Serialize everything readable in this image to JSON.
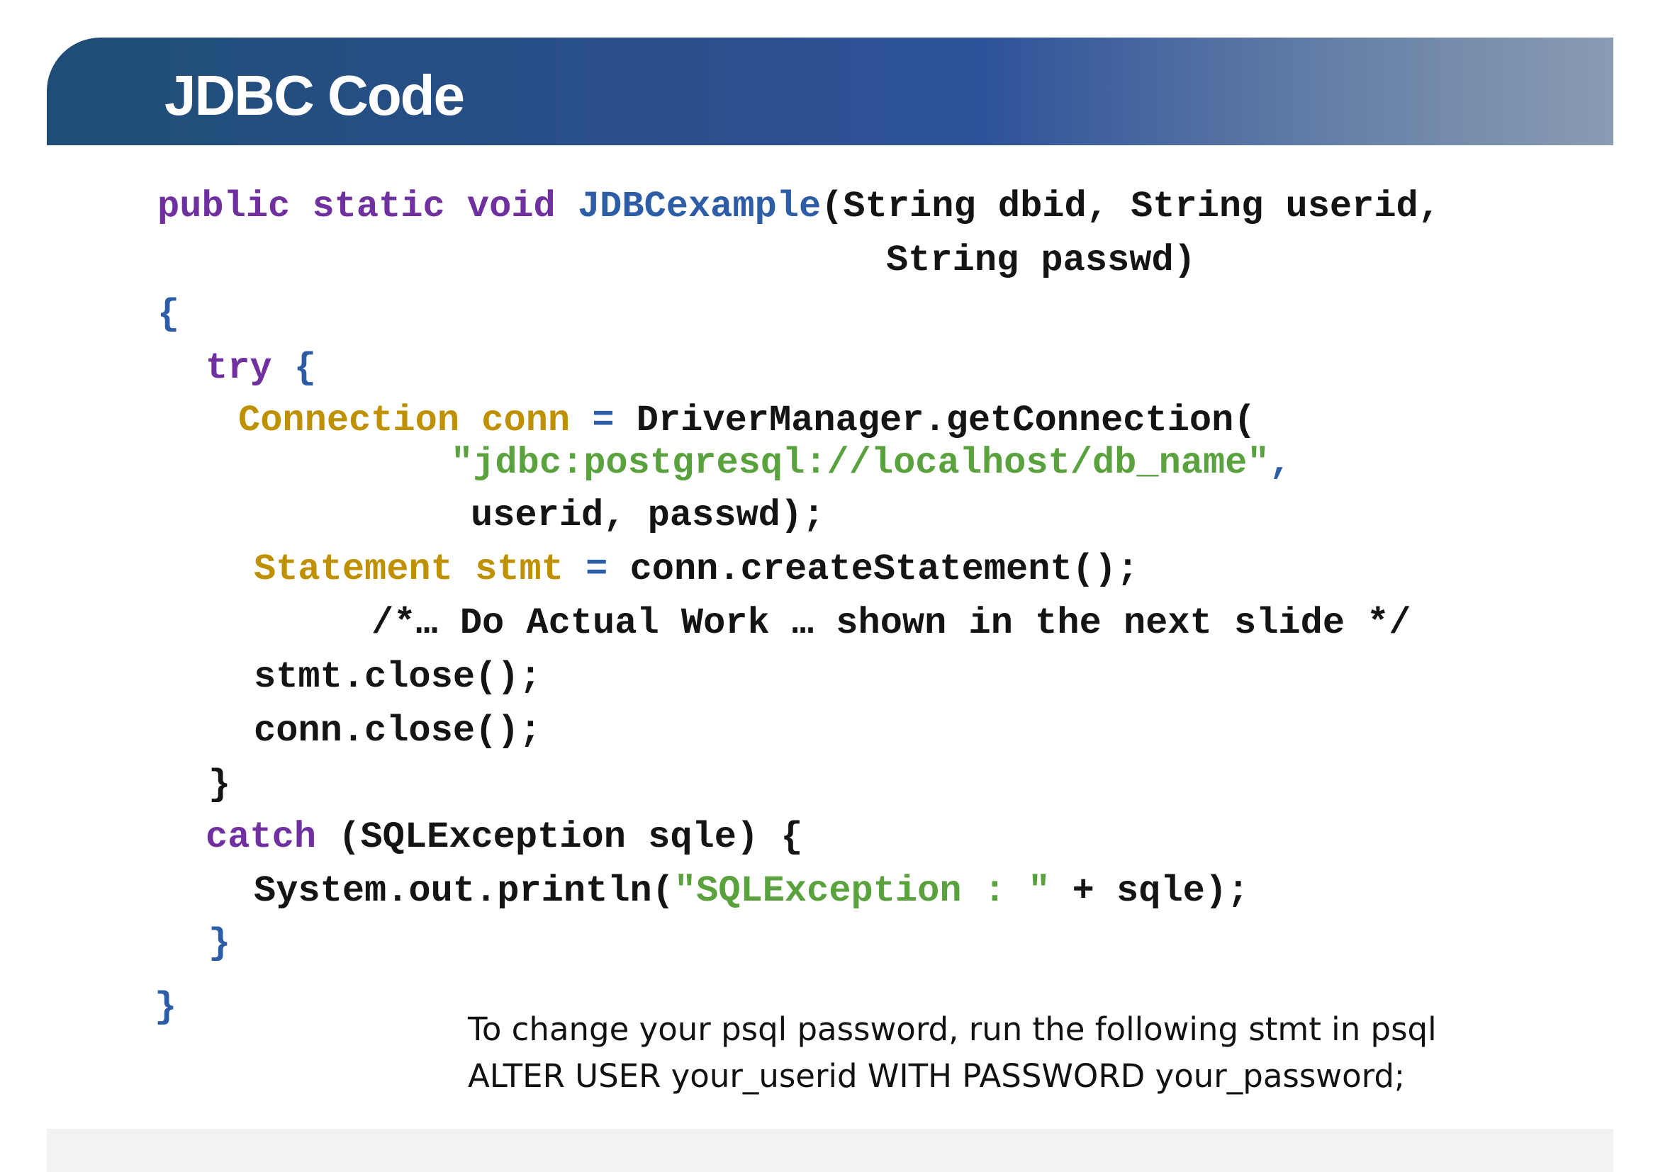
{
  "slide": {
    "title": "JDBC Code"
  },
  "code": {
    "l1": {
      "kw_public": "public",
      "kw_static": "static",
      "kw_void": "void",
      "method": "JDBCexample",
      "params": "(String dbid, String userid,"
    },
    "l2": {
      "params": "String passwd)"
    },
    "l3": {
      "brace": "{"
    },
    "l4": {
      "kw_try": "try",
      "brace": "{"
    },
    "l5": {
      "type": "Connection",
      "var": "conn",
      "op": "=",
      "call": "DriverManager.getConnection("
    },
    "l6": {
      "string": "\"jdbc:postgresql://localhost/db_name\"",
      "comma": ","
    },
    "l7": {
      "args": "userid, passwd);"
    },
    "l8": {
      "type": "Statement",
      "var": "stmt",
      "op": "=",
      "call": "conn.createStatement();"
    },
    "l9": {
      "comment": "/*… Do Actual Work … shown in the next slide */"
    },
    "l10": {
      "text": "stmt.close();"
    },
    "l11": {
      "text": "conn.close();"
    },
    "l12": {
      "brace": "}"
    },
    "l13": {
      "kw_catch": "catch",
      "rest": "(SQLException sqle) {"
    },
    "l14": {
      "prefix": "System.out.println(",
      "string": "\"SQLException : \"",
      "suffix": "+ sqle);"
    },
    "l15": {
      "brace": "}"
    },
    "l16": {
      "brace": "}"
    }
  },
  "note": {
    "line1": "To change your psql password, run the following stmt in psql",
    "line2": "ALTER USER your_userid WITH PASSWORD your_password;"
  },
  "colors": {
    "title_bar_start": "#1f4d77",
    "title_bar_end": "#8a9cb3",
    "keyword": "#7030a0",
    "method_and_braces": "#2e5da8",
    "type_and_variable": "#bf9000",
    "string": "#5aa23e",
    "code_text": "#141414"
  }
}
